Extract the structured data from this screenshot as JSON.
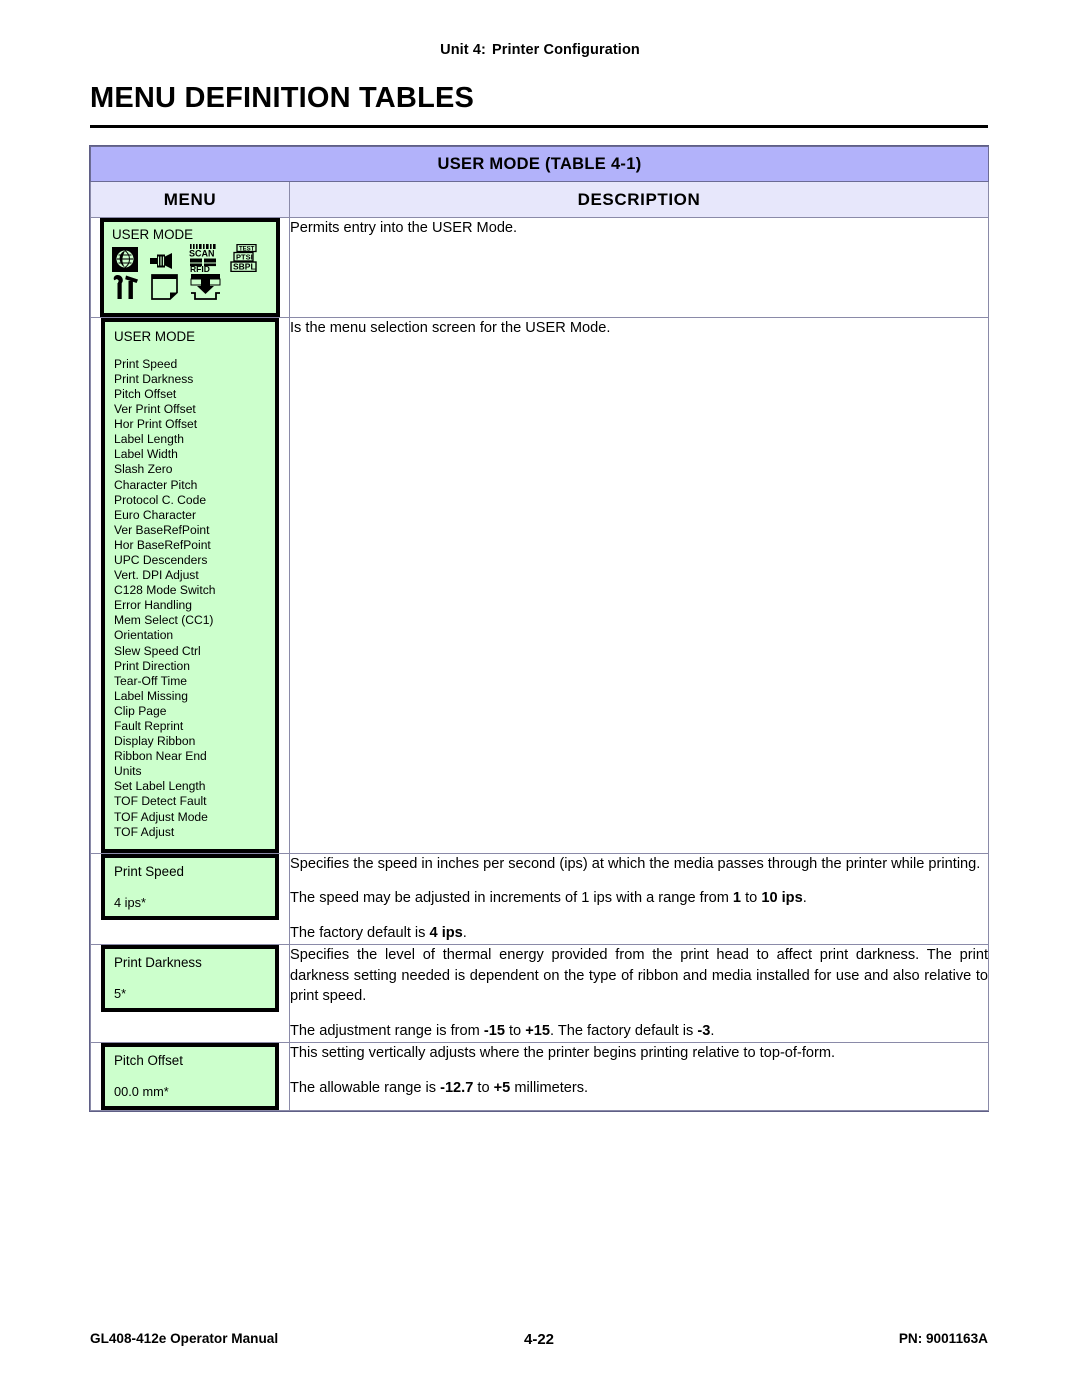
{
  "header": {
    "unit_label": "Unit 4:",
    "unit_title": "Printer Configuration"
  },
  "page_title": "MENU DEFINITION TABLES",
  "table": {
    "caption": "USER MODE (TABLE 4-1)",
    "columns": [
      "MENU",
      "DESCRIPTION"
    ],
    "rows": [
      {
        "menu_type": "icon-screen",
        "lcd_title": "USER MODE",
        "icons": [
          "globe-world-icon",
          "plug-connector-icon",
          "scan-rfid-icon",
          "test-ptsi-sbpl-icon",
          "wrench-hammer-tools-icon",
          "page-document-icon",
          "download-save-icon"
        ],
        "icon_labels": [
          "SCAN",
          "RFID",
          "TEST",
          "PTSI",
          "SBPL"
        ],
        "description": [
          "Permits entry into the USER Mode."
        ]
      },
      {
        "menu_type": "menu-list",
        "lcd_title": "USER MODE",
        "items": [
          "Print Speed",
          "Print Darkness",
          "Pitch Offset",
          "Ver Print Offset",
          "Hor Print Offset",
          "Label Length",
          "Label Width",
          "Slash Zero",
          "Character Pitch",
          "Protocol C. Code",
          "Euro Character",
          "Ver BaseRefPoint",
          "Hor BaseRefPoint",
          "UPC Descenders",
          "Vert. DPI Adjust",
          "C128 Mode Switch",
          "Error Handling",
          "Mem Select (CC1)",
          "Orientation",
          "Slew Speed Ctrl",
          "Print Direction",
          "Tear-Off Time",
          "Label Missing",
          "Clip Page",
          "Fault Reprint",
          "Display Ribbon",
          "Ribbon Near End",
          "Units",
          "Set Label Length",
          "TOF Detect Fault",
          "TOF Adjust Mode",
          "TOF Adjust"
        ],
        "description": [
          "Is the menu selection screen for the USER Mode."
        ]
      },
      {
        "menu_type": "setting",
        "lcd_title": "Print Speed",
        "lcd_value": "4 ips*",
        "description": [
          "Specifies the speed in inches per second (ips) at which the media passes through the printer while printing.",
          "The speed may be adjusted in increments of 1 ips with a range from <b>1</b> to <b>10 ips</b>.",
          "The factory default is <b>4 ips</b>."
        ]
      },
      {
        "menu_type": "setting",
        "lcd_title": "Print Darkness",
        "lcd_value": "5*",
        "description": [
          "Specifies the level of thermal energy provided from the print head to affect print darkness. The print darkness setting needed is dependent on the type of ribbon and media installed for use and also relative to print speed.",
          "The adjustment range is from <b>-15</b> to <b>+15</b>. The factory default is <b>-3</b>."
        ]
      },
      {
        "menu_type": "setting",
        "lcd_title": "Pitch Offset",
        "lcd_value": "00.0 mm*",
        "description": [
          "This setting vertically adjusts where the printer begins printing relative to top-of-form.",
          "The allowable range is <b>-12.7</b> to <b>+5</b> millimeters."
        ]
      }
    ]
  },
  "footer": {
    "left": "GL408-412e Operator Manual",
    "center": "4-22",
    "right": "PN: 9001163A"
  },
  "colors": {
    "table_caption_bg": "#b2b2fa",
    "table_header_bg": "#e7e7fb",
    "lcd_green": "#ccffcc",
    "rule": "#000000"
  }
}
